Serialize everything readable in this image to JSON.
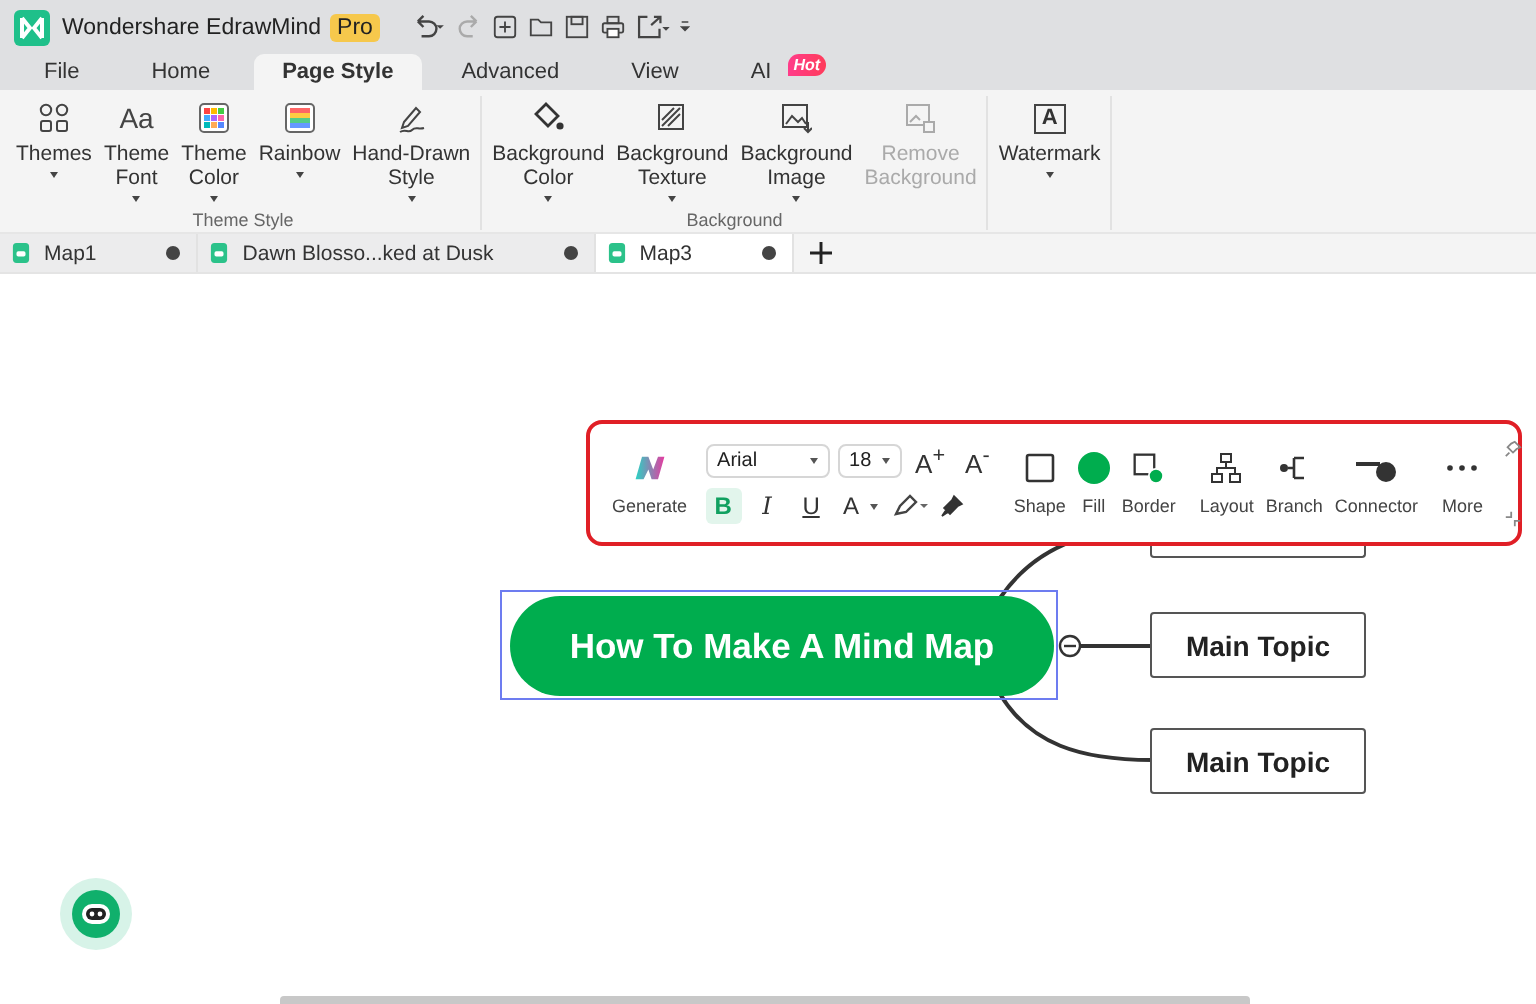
{
  "app": {
    "name": "Wondershare EdrawMind",
    "badge": "Pro"
  },
  "menu_tabs": [
    {
      "label": "File",
      "selected": false
    },
    {
      "label": "Home",
      "selected": false
    },
    {
      "label": "Page Style",
      "selected": true
    },
    {
      "label": "Advanced",
      "selected": false
    },
    {
      "label": "View",
      "selected": false
    },
    {
      "label": "AI",
      "selected": false,
      "badge": "Hot"
    }
  ],
  "ribbon_groups": [
    {
      "label": "Theme Style",
      "items": [
        {
          "lines": [
            "Themes"
          ],
          "dropdown": true,
          "disabled": false
        },
        {
          "lines": [
            "Theme",
            "Font"
          ],
          "dropdown": true,
          "disabled": false,
          "icon_text": "Aa"
        },
        {
          "lines": [
            "Theme",
            "Color"
          ],
          "dropdown": true,
          "disabled": false
        },
        {
          "lines": [
            "Rainbow"
          ],
          "dropdown": true,
          "disabled": false
        },
        {
          "lines": [
            "Hand-Drawn",
            "Style"
          ],
          "dropdown": true,
          "disabled": false
        }
      ]
    },
    {
      "label": "Background",
      "items": [
        {
          "lines": [
            "Background",
            "Color"
          ],
          "dropdown": true,
          "disabled": false
        },
        {
          "lines": [
            "Background",
            "Texture"
          ],
          "dropdown": true,
          "disabled": false
        },
        {
          "lines": [
            "Background",
            "Image"
          ],
          "dropdown": true,
          "disabled": false
        },
        {
          "lines": [
            "Remove",
            "Background"
          ],
          "dropdown": false,
          "disabled": true
        }
      ]
    },
    {
      "items": [
        {
          "lines": [
            "Watermark"
          ],
          "dropdown": true,
          "disabled": false,
          "icon_text": "A"
        }
      ]
    }
  ],
  "doc_tabs": [
    {
      "label": "Map1",
      "selected": false
    },
    {
      "label": "Dawn Blosso...ked at Dusk",
      "selected": false
    },
    {
      "label": "Map3",
      "selected": true
    }
  ],
  "format_toolbar": {
    "generate": "Generate",
    "font": "Arial",
    "size": "18",
    "size_buttons": [
      "A$^{+}$",
      "A$^{-}$"
    ],
    "style_buttons": [
      {
        "glyph": "B",
        "kind": "bold",
        "selected": true
      },
      {
        "glyph": "I",
        "kind": "italic",
        "selected": false
      },
      {
        "glyph": "U",
        "kind": "underline",
        "selected": false
      },
      {
        "glyph": "A",
        "kind": "font-color",
        "selected": false
      }
    ],
    "tool_groups": [
      [
        "Shape",
        "Fill",
        "Border"
      ],
      [
        "Layout",
        "Branch",
        "Connector"
      ]
    ],
    "more": "More"
  },
  "mind_map": {
    "central": {
      "label": "How To Make A Mind Map",
      "selected": true
    },
    "topics": [
      {
        "label": "Main Topic"
      },
      {
        "label": "Main Topic"
      }
    ]
  }
}
